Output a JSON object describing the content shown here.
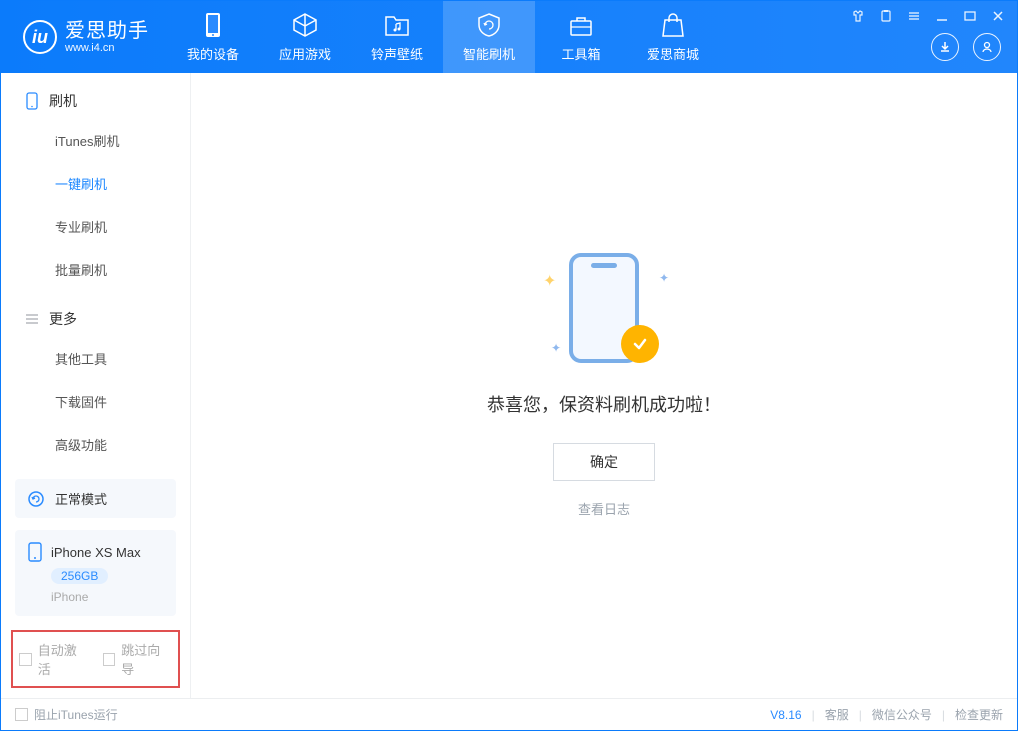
{
  "app": {
    "title": "爱思助手",
    "subtitle": "www.i4.cn"
  },
  "nav": {
    "tabs": [
      {
        "label": "我的设备"
      },
      {
        "label": "应用游戏"
      },
      {
        "label": "铃声壁纸"
      },
      {
        "label": "智能刷机"
      },
      {
        "label": "工具箱"
      },
      {
        "label": "爱思商城"
      }
    ]
  },
  "sidebar": {
    "group1_title": "刷机",
    "group1_items": [
      "iTunes刷机",
      "一键刷机",
      "专业刷机",
      "批量刷机"
    ],
    "group2_title": "更多",
    "group2_items": [
      "其他工具",
      "下载固件",
      "高级功能"
    ],
    "mode_label": "正常模式",
    "device_name": "iPhone XS Max",
    "device_storage": "256GB",
    "device_type": "iPhone",
    "option_auto_activate": "自动激活",
    "option_skip_guide": "跳过向导"
  },
  "main": {
    "success_text": "恭喜您，保资料刷机成功啦！",
    "ok_button": "确定",
    "view_log": "查看日志"
  },
  "footer": {
    "block_itunes": "阻止iTunes运行",
    "version": "V8.16",
    "links": [
      "客服",
      "微信公众号",
      "检查更新"
    ]
  }
}
